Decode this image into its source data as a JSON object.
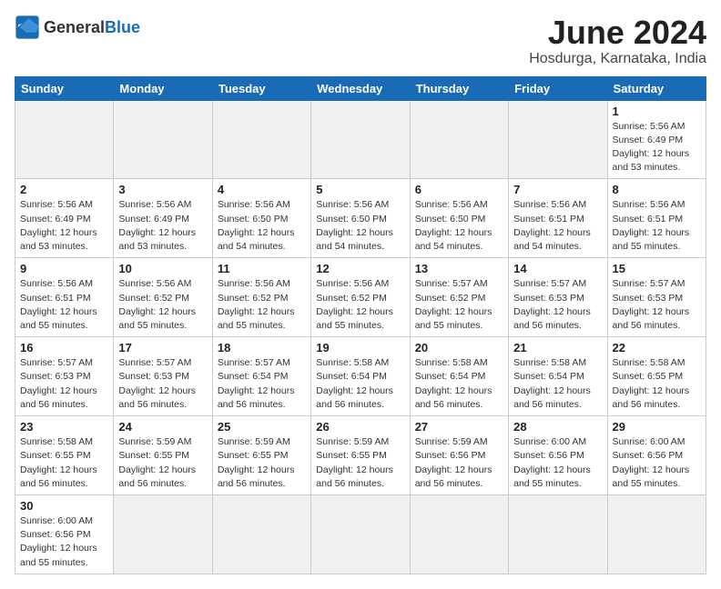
{
  "header": {
    "logo_general": "General",
    "logo_blue": "Blue",
    "month_title": "June 2024",
    "location": "Hosdurga, Karnataka, India"
  },
  "days_of_week": [
    "Sunday",
    "Monday",
    "Tuesday",
    "Wednesday",
    "Thursday",
    "Friday",
    "Saturday"
  ],
  "weeks": [
    [
      {
        "day": "",
        "empty": true
      },
      {
        "day": "",
        "empty": true
      },
      {
        "day": "",
        "empty": true
      },
      {
        "day": "",
        "empty": true
      },
      {
        "day": "",
        "empty": true
      },
      {
        "day": "",
        "empty": true
      },
      {
        "day": "1",
        "sunrise": "5:56 AM",
        "sunset": "6:49 PM",
        "daylight": "12 hours and 53 minutes."
      }
    ],
    [
      {
        "day": "2",
        "sunrise": "5:56 AM",
        "sunset": "6:49 PM",
        "daylight": "12 hours and 53 minutes."
      },
      {
        "day": "3",
        "sunrise": "5:56 AM",
        "sunset": "6:49 PM",
        "daylight": "12 hours and 53 minutes."
      },
      {
        "day": "4",
        "sunrise": "5:56 AM",
        "sunset": "6:50 PM",
        "daylight": "12 hours and 54 minutes."
      },
      {
        "day": "5",
        "sunrise": "5:56 AM",
        "sunset": "6:50 PM",
        "daylight": "12 hours and 54 minutes."
      },
      {
        "day": "6",
        "sunrise": "5:56 AM",
        "sunset": "6:50 PM",
        "daylight": "12 hours and 54 minutes."
      },
      {
        "day": "7",
        "sunrise": "5:56 AM",
        "sunset": "6:51 PM",
        "daylight": "12 hours and 54 minutes."
      },
      {
        "day": "8",
        "sunrise": "5:56 AM",
        "sunset": "6:51 PM",
        "daylight": "12 hours and 55 minutes."
      }
    ],
    [
      {
        "day": "9",
        "sunrise": "5:56 AM",
        "sunset": "6:51 PM",
        "daylight": "12 hours and 55 minutes."
      },
      {
        "day": "10",
        "sunrise": "5:56 AM",
        "sunset": "6:52 PM",
        "daylight": "12 hours and 55 minutes."
      },
      {
        "day": "11",
        "sunrise": "5:56 AM",
        "sunset": "6:52 PM",
        "daylight": "12 hours and 55 minutes."
      },
      {
        "day": "12",
        "sunrise": "5:56 AM",
        "sunset": "6:52 PM",
        "daylight": "12 hours and 55 minutes."
      },
      {
        "day": "13",
        "sunrise": "5:57 AM",
        "sunset": "6:52 PM",
        "daylight": "12 hours and 55 minutes."
      },
      {
        "day": "14",
        "sunrise": "5:57 AM",
        "sunset": "6:53 PM",
        "daylight": "12 hours and 56 minutes."
      },
      {
        "day": "15",
        "sunrise": "5:57 AM",
        "sunset": "6:53 PM",
        "daylight": "12 hours and 56 minutes."
      }
    ],
    [
      {
        "day": "16",
        "sunrise": "5:57 AM",
        "sunset": "6:53 PM",
        "daylight": "12 hours and 56 minutes."
      },
      {
        "day": "17",
        "sunrise": "5:57 AM",
        "sunset": "6:53 PM",
        "daylight": "12 hours and 56 minutes."
      },
      {
        "day": "18",
        "sunrise": "5:57 AM",
        "sunset": "6:54 PM",
        "daylight": "12 hours and 56 minutes."
      },
      {
        "day": "19",
        "sunrise": "5:58 AM",
        "sunset": "6:54 PM",
        "daylight": "12 hours and 56 minutes."
      },
      {
        "day": "20",
        "sunrise": "5:58 AM",
        "sunset": "6:54 PM",
        "daylight": "12 hours and 56 minutes."
      },
      {
        "day": "21",
        "sunrise": "5:58 AM",
        "sunset": "6:54 PM",
        "daylight": "12 hours and 56 minutes."
      },
      {
        "day": "22",
        "sunrise": "5:58 AM",
        "sunset": "6:55 PM",
        "daylight": "12 hours and 56 minutes."
      }
    ],
    [
      {
        "day": "23",
        "sunrise": "5:58 AM",
        "sunset": "6:55 PM",
        "daylight": "12 hours and 56 minutes."
      },
      {
        "day": "24",
        "sunrise": "5:59 AM",
        "sunset": "6:55 PM",
        "daylight": "12 hours and 56 minutes."
      },
      {
        "day": "25",
        "sunrise": "5:59 AM",
        "sunset": "6:55 PM",
        "daylight": "12 hours and 56 minutes."
      },
      {
        "day": "26",
        "sunrise": "5:59 AM",
        "sunset": "6:55 PM",
        "daylight": "12 hours and 56 minutes."
      },
      {
        "day": "27",
        "sunrise": "5:59 AM",
        "sunset": "6:56 PM",
        "daylight": "12 hours and 56 minutes."
      },
      {
        "day": "28",
        "sunrise": "6:00 AM",
        "sunset": "6:56 PM",
        "daylight": "12 hours and 55 minutes."
      },
      {
        "day": "29",
        "sunrise": "6:00 AM",
        "sunset": "6:56 PM",
        "daylight": "12 hours and 55 minutes."
      }
    ],
    [
      {
        "day": "30",
        "sunrise": "6:00 AM",
        "sunset": "6:56 PM",
        "daylight": "12 hours and 55 minutes."
      },
      {
        "day": "",
        "empty": true
      },
      {
        "day": "",
        "empty": true
      },
      {
        "day": "",
        "empty": true
      },
      {
        "day": "",
        "empty": true
      },
      {
        "day": "",
        "empty": true
      },
      {
        "day": "",
        "empty": true
      }
    ]
  ]
}
